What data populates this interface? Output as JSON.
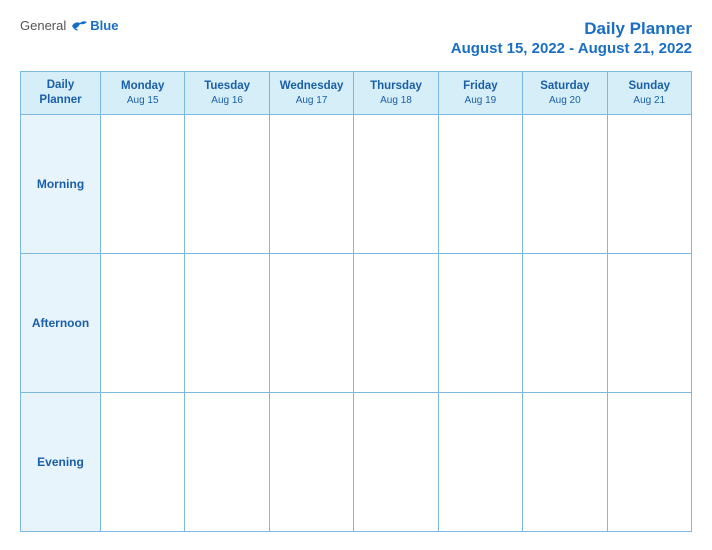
{
  "header": {
    "logo_general": "General",
    "logo_blue": "Blue",
    "title": "Daily Planner",
    "date_range": "August 15, 2022 - August 21, 2022"
  },
  "calendar": {
    "header_label": "Daily\nPlanner",
    "days": [
      {
        "name": "Monday",
        "date": "Aug 15"
      },
      {
        "name": "Tuesday",
        "date": "Aug 16"
      },
      {
        "name": "Wednesday",
        "date": "Aug 17"
      },
      {
        "name": "Thursday",
        "date": "Aug 18"
      },
      {
        "name": "Friday",
        "date": "Aug 19"
      },
      {
        "name": "Saturday",
        "date": "Aug 20"
      },
      {
        "name": "Sunday",
        "date": "Aug 21"
      }
    ],
    "rows": [
      {
        "label": "Morning"
      },
      {
        "label": "Afternoon"
      },
      {
        "label": "Evening"
      }
    ]
  }
}
